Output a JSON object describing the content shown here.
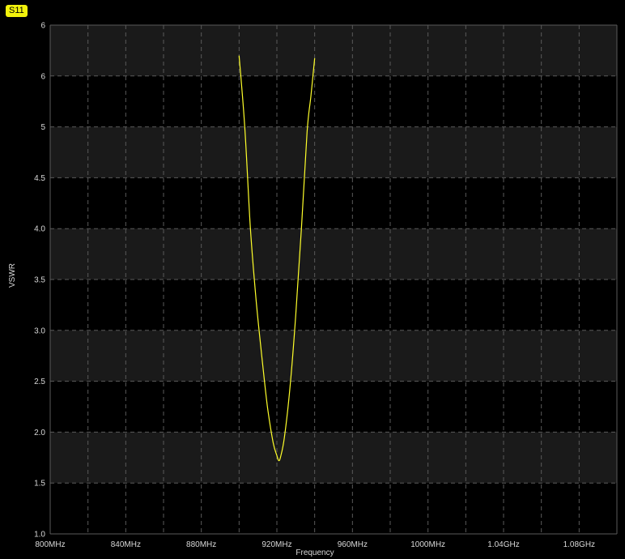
{
  "trace_label": "S11",
  "colors": {
    "background": "#000000",
    "band_dark": "#1a1a1a",
    "grid": "#5a5a5a",
    "trace": "#ffff2a",
    "badge": "#f2f20c",
    "text": "#d8d8d8"
  },
  "chart_data": {
    "type": "line",
    "xlabel": "Frequency",
    "ylabel": "VSWR",
    "x_tick_labels": [
      "800MHz",
      "840MHz",
      "880MHz",
      "920MHz",
      "960MHz",
      "1000MHz",
      "1.04GHz",
      "1.08GHz"
    ],
    "x_tick_values_mhz": [
      800,
      840,
      880,
      920,
      960,
      1000,
      1040,
      1080
    ],
    "xlim_mhz": [
      800,
      1100
    ],
    "y_tick_labels": [
      "1.0",
      "1.5",
      "2.0",
      "2.5",
      "3.0",
      "3.5",
      "4.0",
      "4.5",
      "5",
      "6",
      "6"
    ],
    "y_divisions": 10,
    "grid": true,
    "series": [
      {
        "x_mhz": [
          900,
          903,
          906,
          909,
          912,
          915,
          918,
          920,
          921,
          922,
          924,
          927,
          930,
          933,
          936,
          938,
          940
        ],
        "vswr": [
          6.4,
          5.0,
          4.0,
          3.3,
          2.75,
          2.25,
          1.9,
          1.77,
          1.72,
          1.76,
          1.95,
          2.45,
          3.15,
          4.0,
          4.95,
          5.6,
          6.35
        ]
      }
    ]
  }
}
